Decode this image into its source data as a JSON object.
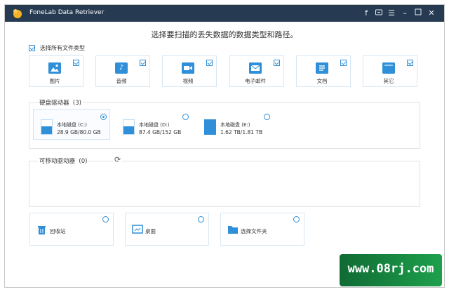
{
  "app": {
    "title": "FoneLab Data Retriever"
  },
  "titlebar_icons": [
    "facebook-icon",
    "chat-icon",
    "menu-icon",
    "minimize-icon",
    "maximize-icon",
    "close-icon"
  ],
  "headline": "选择要扫描的丢失数据的数据类型和路径。",
  "select_all": {
    "label": "选择所有文件类型",
    "checked": true
  },
  "file_types": [
    {
      "label": "图片",
      "icon": "image-icon",
      "checked": true
    },
    {
      "label": "音频",
      "icon": "music-icon",
      "checked": true
    },
    {
      "label": "视频",
      "icon": "video-icon",
      "checked": true
    },
    {
      "label": "电子邮件",
      "icon": "email-icon",
      "checked": true
    },
    {
      "label": "文档",
      "icon": "document-icon",
      "checked": true
    },
    {
      "label": "其它",
      "icon": "folder-icon",
      "checked": true
    }
  ],
  "hard_drives": {
    "title": "硬盘驱动器",
    "count": "(3)",
    "drives": [
      {
        "name": "本地磁盘 (C:)",
        "size": "28.9 GB/80.0 GB",
        "selected": true
      },
      {
        "name": "本地磁盘 (D:)",
        "size": "87.4 GB/152 GB",
        "selected": false
      },
      {
        "name": "本地磁盘 (E:)",
        "size": "1.62 TB/1.81 TB",
        "selected": false
      }
    ]
  },
  "removable": {
    "title": "可移动驱动器",
    "count": "(0)"
  },
  "locations": [
    {
      "label": "回收站",
      "icon": "recycle-bin-icon"
    },
    {
      "label": "桌面",
      "icon": "desktop-icon"
    },
    {
      "label": "选择文件夹",
      "icon": "folder-icon"
    }
  ],
  "watermark": "www.08rj.com",
  "colors": {
    "titlebar": "#263b52",
    "accent": "#2f8fd8",
    "watermark": "#1a8f43"
  }
}
